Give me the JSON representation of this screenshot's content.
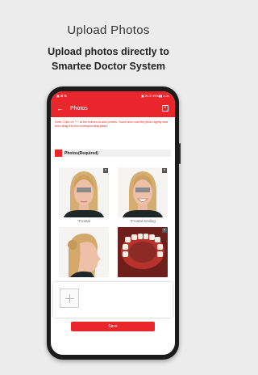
{
  "headline": {
    "title": "Upload Photos",
    "subtitle_line1": "Upload photos directly to",
    "subtitle_line2": "Smartee Doctor System"
  },
  "status_bar": {
    "left": "▣ ⊠ ⊞",
    "right": "▣ ✉ ⊡ 99%▮▮ 4:3x"
  },
  "app": {
    "title": "Photos",
    "note": "Note: Click on \"+\" at the bottom to add photos. Touch and hold the photo tightly and then drag it to the corresponding place.",
    "section_label": "Photos(Required)",
    "photos": [
      {
        "label": "*Frontal"
      },
      {
        "label": "*Frontal Smiling"
      }
    ],
    "save_label": "Save"
  },
  "colors": {
    "accent": "#e8262b",
    "background": "#ececec"
  }
}
